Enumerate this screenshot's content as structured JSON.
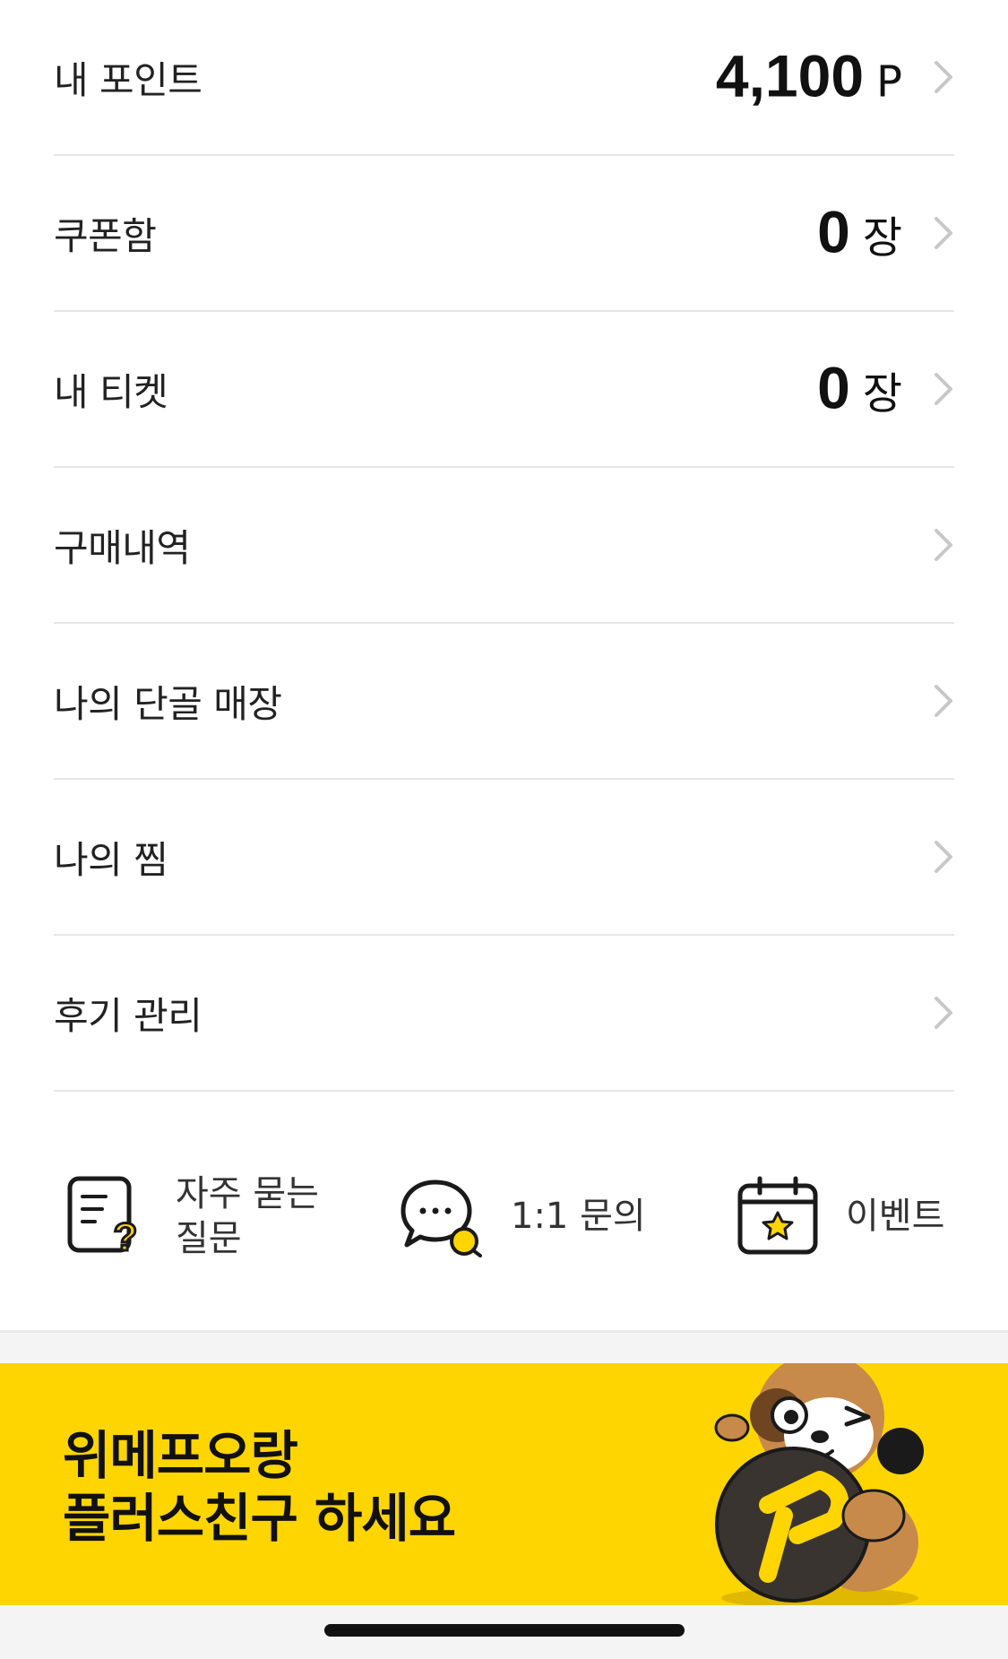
{
  "menu": {
    "points": {
      "label": "내 포인트",
      "value": "4,100",
      "unit": "P"
    },
    "coupons": {
      "label": "쿠폰함",
      "value": "0",
      "unit": "장"
    },
    "tickets": {
      "label": "내 티켓",
      "value": "0",
      "unit": "장"
    },
    "purchases": {
      "label": "구매내역"
    },
    "favorite_stores": {
      "label": "나의 단골 매장"
    },
    "wishlist": {
      "label": "나의 찜"
    },
    "reviews": {
      "label": "후기 관리"
    }
  },
  "quick_links": {
    "faq": {
      "line1": "자주 묻는",
      "line2": "질문",
      "icon": "faq-document-icon"
    },
    "inquiry": {
      "label": "1:1 문의",
      "icon": "chat-bubble-icon"
    },
    "events": {
      "label": "이벤트",
      "icon": "calendar-star-icon"
    }
  },
  "banner": {
    "line1": "위메프오랑",
    "line2": "플러스친구 하세요",
    "image": "mascot-with-point-coin"
  },
  "colors": {
    "accent_yellow": "#ffd500",
    "divider": "#e6e6e6",
    "text": "#222222",
    "chevron": "#c8c8c8"
  }
}
